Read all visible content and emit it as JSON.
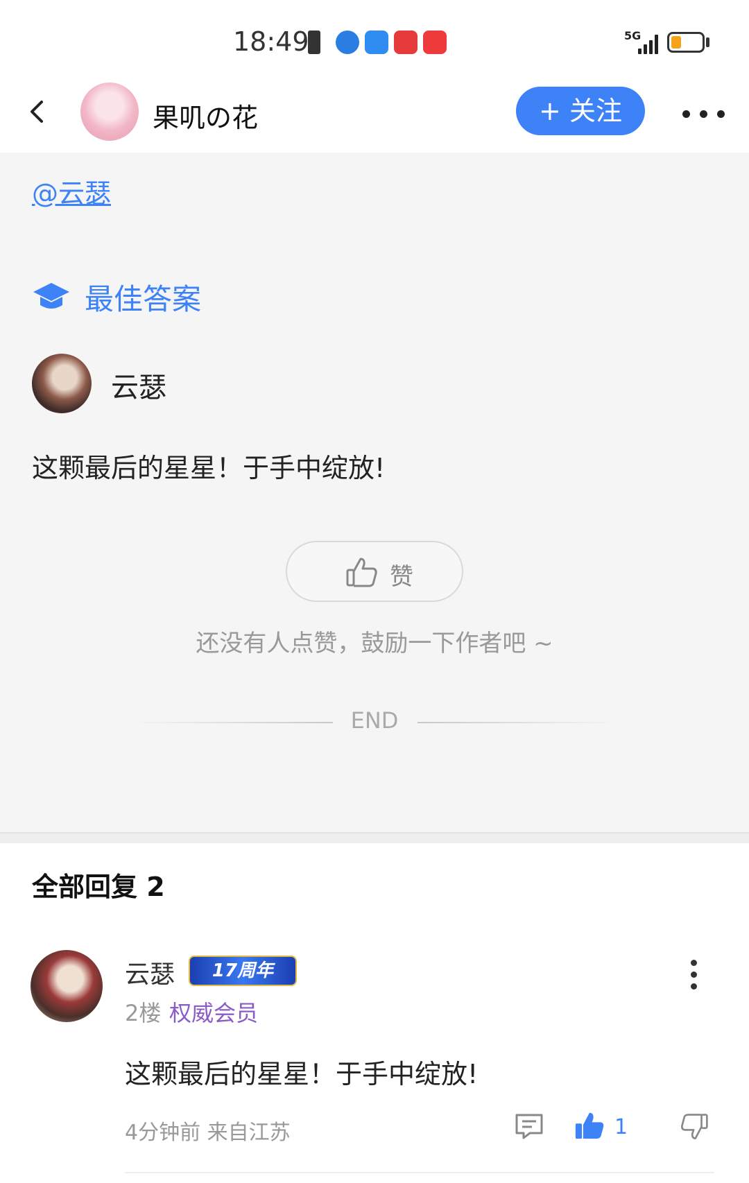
{
  "status": {
    "time": "18:49",
    "network": "5G",
    "app_icons": [
      "notification-icon",
      "browser-icon",
      "cloud-icon",
      "reader-icon",
      "huawei-store-icon"
    ]
  },
  "header": {
    "title": "果叽の花",
    "follow_label": "+ 关注"
  },
  "post": {
    "mention": "@云瑟",
    "best_answer_label": "最佳答案",
    "answer_author": "云瑟",
    "answer_text": "这颗最后的星星！于手中绽放!",
    "like_label": "赞",
    "encourage_text": "还没有人点赞，鼓励一下作者吧 ~",
    "end_text": "END"
  },
  "replies": {
    "title": "全部回复  2",
    "items": [
      {
        "author": "云瑟",
        "badge": "17周年",
        "floor": "2楼",
        "role": "权威会员",
        "text": "这颗最后的星星！于手中绽放!",
        "meta": "4分钟前 来自江苏",
        "likes": "1"
      }
    ]
  },
  "colors": {
    "accent": "#3d82f6",
    "page_bg": "#f5f5f5",
    "role_purple": "#8a5cc7"
  }
}
